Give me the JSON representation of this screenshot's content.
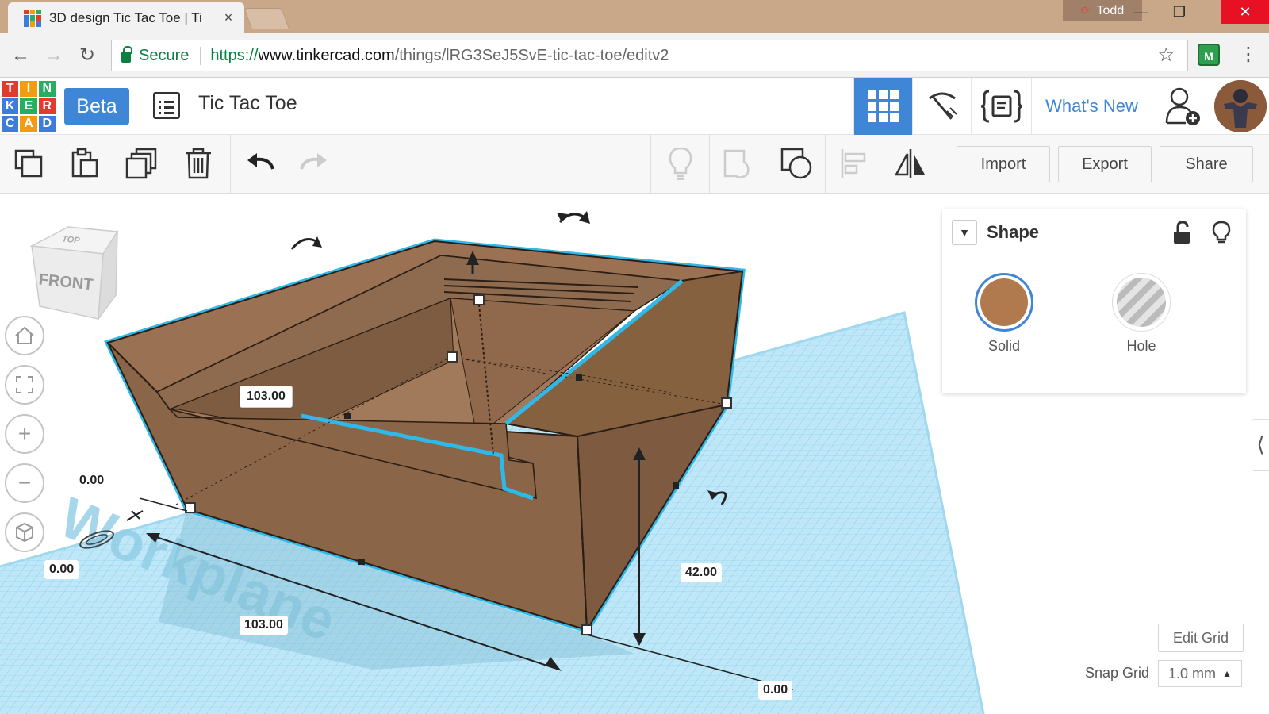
{
  "browser": {
    "tab_title": "3D design Tic Tac Toe | Ti",
    "tab_close": "×",
    "user_name": "Todd",
    "window_controls": [
      "—",
      "❐",
      "✕"
    ],
    "secure_label": "Secure",
    "url_scheme": "https://",
    "url_host": "www.tinkercad.com",
    "url_path": "/things/lRG3SeJ5SvE-tic-tac-toe/editv2",
    "extension_letter": "M"
  },
  "header": {
    "logo_letters": [
      "T",
      "I",
      "N",
      "K",
      "E",
      "R",
      "C",
      "A",
      "D"
    ],
    "logo_colors": [
      "#e03b2d",
      "#f39c12",
      "#27ae60",
      "#3b7dd8",
      "#27ae60",
      "#e03b2d",
      "#3b7dd8",
      "#f39c12",
      "#3b7dd8"
    ],
    "beta_label": "Beta",
    "design_title": "Tic Tac Toe",
    "whats_new": "What's New",
    "accent_color": "#3f86d6"
  },
  "toolbar": {
    "import_label": "Import",
    "export_label": "Export",
    "share_label": "Share"
  },
  "viewcube": {
    "top_face": "TOP",
    "front_face": "FRONT"
  },
  "dimensions": {
    "width_top": "103.00",
    "width_bottom": "103.00",
    "height": "42.00",
    "offset_left": "0.00",
    "offset_bottom_left": "0.00",
    "offset_bottom_right": "0.00"
  },
  "workplane_label": "Workplane",
  "inspector": {
    "title": "Shape",
    "solid_label": "Solid",
    "hole_label": "Hole",
    "solid_color": "#b07a4e"
  },
  "grid": {
    "edit_grid_label": "Edit Grid",
    "snap_label": "Snap Grid",
    "snap_value": "1.0 mm"
  }
}
